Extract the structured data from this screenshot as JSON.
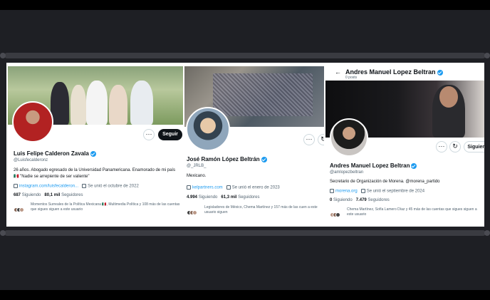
{
  "profiles": [
    {
      "name": "Luis Felipe Calderon Zavala",
      "handle": "@Luisfecalderonz",
      "bio": "26 años. Abogado egresado de la Universidad Panamericana. Enamorado de mi país 🇲🇽 \"Nadie se arrepiente de ser valiente\"",
      "link": "instagram.com/luisfecalderon...",
      "joined": "Se unió el octubre de 2022",
      "following_count": "687",
      "following_label": "Siguiendo",
      "followers_count": "80,1 mil",
      "followers_label": "Seguidores",
      "followed_by": "Momentos Surreales de la Política Mexicana 🇲🇽, Multimedia Política y 108 más de las cuentas que sigues siguen a este usuario",
      "action": "Seguir"
    },
    {
      "name": "José Ramón López Beltrán",
      "handle": "@_JRLB_",
      "bio": "Mexicano.",
      "link": "kelpartners.com",
      "joined": "Se unió el enero de 2023",
      "following_count": "4.994",
      "following_label": "Siguiendo",
      "followers_count": "61,3 mil",
      "followers_label": "Seguidores",
      "followed_by": "Legisladores de México, Chema Martínez y 157 más de las cuen a este usuario siguen"
    },
    {
      "top_title": "Andres Manuel Lopez Beltran",
      "top_sub": "0 posts",
      "name": "Andres Manuel Lopez Beltran",
      "handle": "@amlopezbeltran",
      "bio": "Secretario de Organización de Morena. @morena_partido",
      "link": "morena.org",
      "joined": "Se unió el septiembre de 2024",
      "following_count": "0",
      "following_label": "Siguiendo",
      "followers_count": "7.479",
      "followers_label": "Seguidores",
      "followed_by": "Chema Martínez, Sofía Lamero Díaz y 45 más de las cuentas que sigues siguen a este usuario",
      "action": "Siguien"
    }
  ],
  "icons": [
    "more-icon",
    "notify-icon",
    "verified-icon",
    "link-icon",
    "calendar-icon",
    "back-arrow-icon"
  ]
}
